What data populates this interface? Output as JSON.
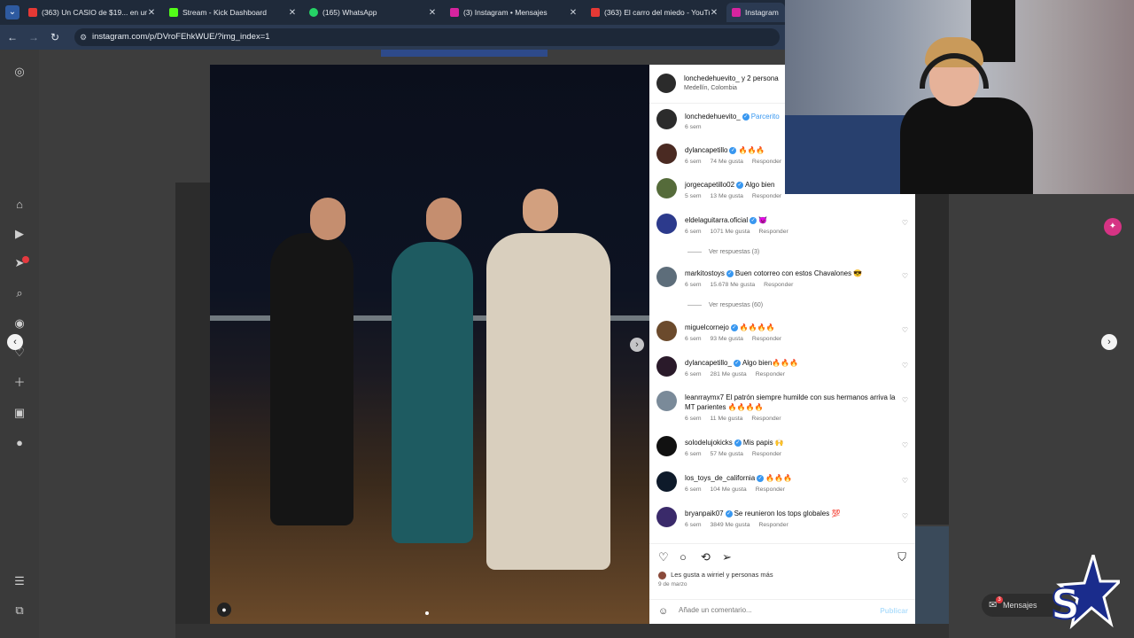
{
  "browser": {
    "tabs": [
      {
        "title": "(363) Un CASIO de $19... en un",
        "icon": "youtube-icon",
        "color": "#e53935"
      },
      {
        "title": "Stream - Kick Dashboard",
        "icon": "kick-icon",
        "color": "#53fc18"
      },
      {
        "title": "(165) WhatsApp",
        "icon": "whatsapp-icon",
        "color": "#25d366"
      },
      {
        "title": "(3) Instagram • Mensajes",
        "icon": "instagram-icon",
        "color": "#d6249f"
      },
      {
        "title": "(363) El carro del miedo - YouTu...",
        "icon": "youtube-icon",
        "color": "#e53935"
      },
      {
        "title": "Instagram",
        "icon": "instagram-icon",
        "color": "#d6249f"
      }
    ],
    "url": "instagram.com/p/DVroFEhkWUE/?img_index=1"
  },
  "post": {
    "header_user": "lonchedehuevito_",
    "header_others": "y 2 persona",
    "location": "Medellín, Colombia",
    "caption_user": "lonchedehuevito_",
    "caption_text": "Parcerito",
    "caption_age": "6 sem",
    "comments": [
      {
        "user": "dylancapetillo",
        "verified": true,
        "text": "🔥🔥🔥",
        "age": "6 sem",
        "likes": "74 Me gusta",
        "reply": "Responder"
      },
      {
        "user": "jorgecapetillo02",
        "verified": true,
        "text": "Algo bien",
        "age": "5 sem",
        "likes": "13 Me gusta",
        "reply": "Responder"
      },
      {
        "user": "eldelaguitarra.oficial",
        "verified": true,
        "text": "😈",
        "age": "6 sem",
        "likes": "1071 Me gusta",
        "reply": "Responder",
        "replies": "Ver respuestas (3)"
      },
      {
        "user": "markitostoys",
        "verified": true,
        "text": "Buen cotorreo con estos Chavalones 😎",
        "age": "6 sem",
        "likes": "15.678 Me gusta",
        "reply": "Responder",
        "replies": "Ver respuestas (60)"
      },
      {
        "user": "miguelcornejo",
        "verified": true,
        "text": "🔥🔥🔥🔥",
        "age": "6 sem",
        "likes": "93 Me gusta",
        "reply": "Responder"
      },
      {
        "user": "dylancapetillo_",
        "verified": true,
        "text": "Algo bien🔥🔥🔥",
        "age": "6 sem",
        "likes": "281 Me gusta",
        "reply": "Responder"
      },
      {
        "user": "leanrraymx7",
        "verified": false,
        "text": "El patrón siempre humilde con sus hermanos arriva la MT parientes 🔥🔥🔥🔥",
        "age": "6 sem",
        "likes": "11 Me gusta",
        "reply": "Responder"
      },
      {
        "user": "solodelujokicks",
        "verified": true,
        "text": "Mis papis 🙌",
        "age": "6 sem",
        "likes": "57 Me gusta",
        "reply": "Responder"
      },
      {
        "user": "los_toys_de_california",
        "verified": true,
        "text": "🔥🔥🔥",
        "age": "6 sem",
        "likes": "104 Me gusta",
        "reply": "Responder"
      },
      {
        "user": "bryanpaik07",
        "verified": true,
        "text": "Se reunieron los tops globales 💯",
        "age": "6 sem",
        "likes": "3849 Me gusta",
        "reply": "Responder"
      }
    ],
    "liked_by_prefix": "Les gusta a",
    "liked_by_user": "wirriel",
    "liked_by_suffix": "y personas más",
    "date": "9 de marzo",
    "comment_placeholder": "Añade un comentario...",
    "publish_label": "Publicar"
  },
  "dm": {
    "label": "Mensajes",
    "badge": "3"
  },
  "colors": {
    "accent": "#3897f0",
    "publish": "#b2dffc"
  }
}
